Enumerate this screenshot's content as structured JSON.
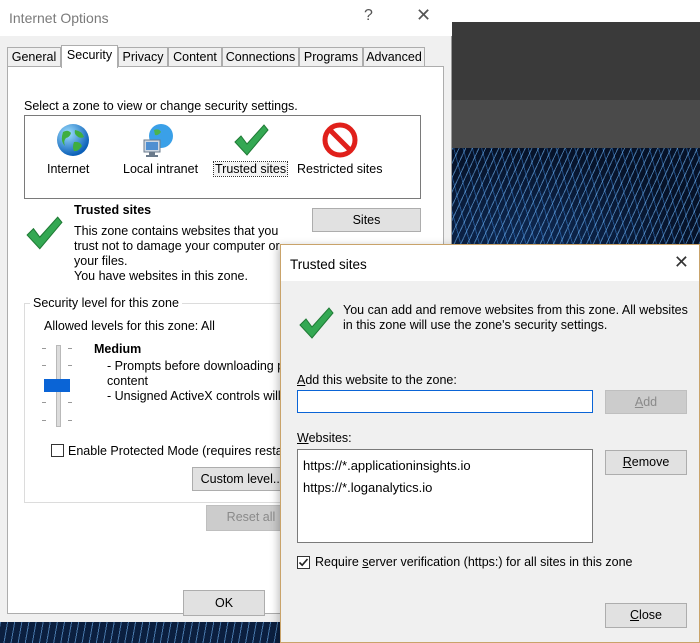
{
  "internet_options": {
    "title": "Internet Options",
    "help_glyph": "?",
    "close_glyph": "✕",
    "tabs": [
      {
        "label": "General"
      },
      {
        "label": "Security"
      },
      {
        "label": "Privacy"
      },
      {
        "label": "Content"
      },
      {
        "label": "Connections"
      },
      {
        "label": "Programs"
      },
      {
        "label": "Advanced"
      }
    ],
    "active_tab": "Security",
    "zone_prompt": "Select a zone to view or change security settings.",
    "zones": [
      {
        "label": "Internet",
        "icon": "globe-icon"
      },
      {
        "label": "Local intranet",
        "icon": "intranet-icon"
      },
      {
        "label": "Trusted sites",
        "icon": "checkmark-icon"
      },
      {
        "label": "Restricted sites",
        "icon": "no-entry-icon"
      }
    ],
    "selected_zone": "Trusted sites",
    "zone_detail": {
      "title": "Trusted sites",
      "description": "This zone contains websites that you\ntrust not to damage your computer or\nyour files.",
      "has_sites": "You have websites in this zone."
    },
    "sites_button": "Sites",
    "security_level": {
      "group_label": "Security level for this zone",
      "allowed": "Allowed levels for this zone: All",
      "level_name": "Medium",
      "level_desc": "- Prompts before downloading p\ncontent\n- Unsigned ActiveX controls will"
    },
    "protected_mode_label": "Enable Protected Mode (requires resta",
    "protected_mode_checked": false,
    "custom_level_button": "Custom level...",
    "reset_all_button": "Reset all",
    "ok_button": "OK"
  },
  "trusted_sites_dialog": {
    "title": "Trusted sites",
    "close_glyph": "✕",
    "info": "You can add and remove websites from this zone. All websites in this zone will use the zone's security settings.",
    "add_label_accel": "A",
    "add_label_rest": "dd this website to the zone:",
    "add_input_value": "",
    "add_button_accel": "A",
    "add_button_rest": "dd",
    "websites_label_accel": "W",
    "websites_label_rest": "ebsites:",
    "websites": [
      "https://*.applicationinsights.io",
      "https://*.loganalytics.io"
    ],
    "remove_button_accel": "R",
    "remove_button_rest": "emove",
    "require_verification_pre": "Require ",
    "require_verification_accel": "s",
    "require_verification_post": "erver verification (https:) for all sites in this zone",
    "require_verification_checked": true,
    "close_button_accel": "C",
    "close_button_rest": "lose"
  },
  "colors": {
    "accent": "#0a64d6",
    "check_green": "#34a853",
    "no_entry_red": "#e0201b"
  }
}
